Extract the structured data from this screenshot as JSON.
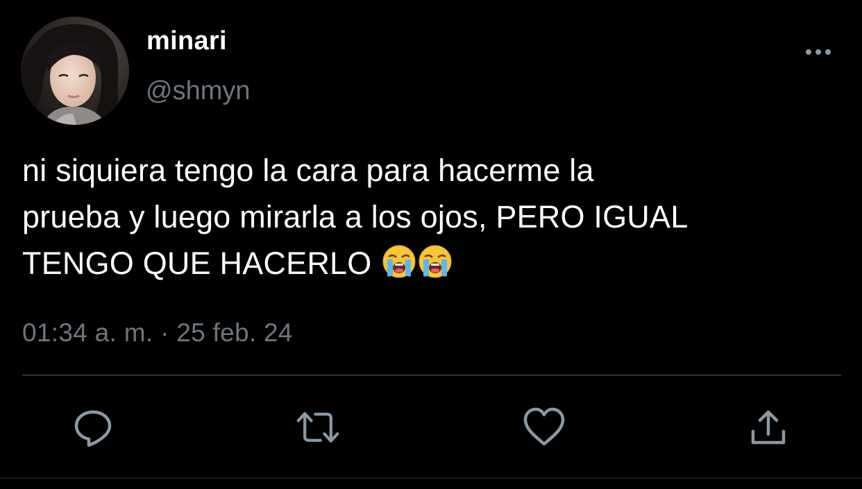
{
  "user": {
    "display_name": "minari",
    "handle": "@shmyn"
  },
  "tweet": {
    "lines": [
      "ni siquiera tengo la cara para hacerme la",
      "prueba y luego mirarla a los ojos, PERO IGUAL",
      "TENGO QUE HACERLO"
    ],
    "emojis": [
      "😭",
      "😭"
    ],
    "timestamp": "01:34 a. m. · 25 feb. 24"
  },
  "actions": {
    "reply_icon": "comment-bubble-icon",
    "retweet_icon": "retweet-icon",
    "like_icon": "heart-icon",
    "share_icon": "share-icon"
  },
  "colors": {
    "background": "#000000",
    "text_primary": "#ffffff",
    "text_secondary": "#6e767d",
    "divider": "#2f3336",
    "icon": "#8b98a5"
  }
}
